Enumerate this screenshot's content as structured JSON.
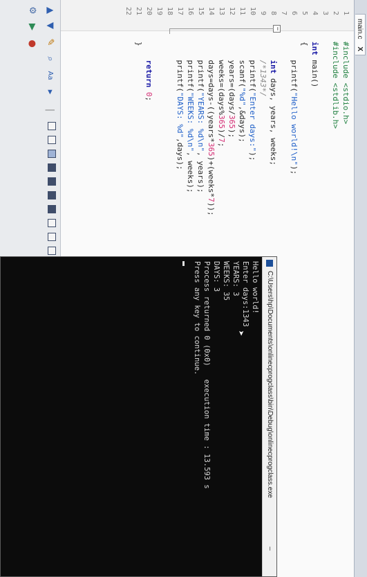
{
  "editor": {
    "tab_label": "main.c",
    "tab_close": "X",
    "line_numbers": [
      "1",
      "2",
      "3",
      "4",
      "5",
      "6",
      "7",
      "8",
      "9",
      "10",
      "11",
      "12",
      "13",
      "14",
      "15",
      "16",
      "17",
      "18",
      "19",
      "20",
      "21",
      "22"
    ],
    "code": {
      "l1_a": "#include ",
      "l1_b": "<stdio.h>",
      "l2_a": "#include ",
      "l2_b": "<stdlib.h>",
      "l4_a": "int",
      "l4_b": " main()",
      "l5": "{",
      "l6_a": "    printf(",
      "l6_b": "\"Hello world!\\n\"",
      "l6_c": ");",
      "l8_a": "    int",
      "l8_b": " days, years, weeks;",
      "l9": "    /*1343*/",
      "l10_a": "    printf(",
      "l10_b": "\"Enter days:\"",
      "l10_c": ");",
      "l11_a": "    scanf(",
      "l11_b": "\"%d\"",
      "l11_c": ",&days);",
      "l12_a": "    years=(days/",
      "l12_b": "365",
      "l12_c": ");",
      "l13_a": "    weeks=(days%",
      "l13_b": "365",
      "l13_c": ")/",
      "l13_d": "7",
      "l13_e": ";",
      "l14_a": "    days=days-((years*",
      "l14_b": "365",
      "l14_c": ")+(weeks*",
      "l14_d": "7",
      "l14_e": "));",
      "l15_a": "    printf(",
      "l15_b": "\"YEARS: %d\\n\"",
      "l15_c": ", years);",
      "l16_a": "    printf(",
      "l16_b": "\"WEEKS: %d\\n\"",
      "l16_c": ", weeks);",
      "l17_a": "    printf(",
      "l17_b": "\"DAYS: %d\"",
      "l17_c": ",days);",
      "l20_a": "    return ",
      "l20_b": "0",
      "l20_c": ";",
      "l21": "}"
    }
  },
  "console": {
    "title": "C:\\Users\\hp\\Documents\\onlinecprogclass\\bin\\Debug\\onlinecprogclass.exe",
    "lines": [
      "Hello world!",
      "Enter days:1343",
      "YEARS: 3",
      "WEEKS: 35",
      "DAYS: 3",
      "Process returned 0 (0x0)   execution time : 13.593 s",
      "Press any key to continue."
    ]
  },
  "colors": {
    "keyword": "#1a1aa6",
    "string": "#1f5fc8",
    "number": "#d42a72",
    "console_bg": "#0c0c0c"
  },
  "toolbar": {
    "icons": [
      "up-arrow-icon",
      "down-arrow-icon",
      "pencil-icon",
      "find-icon",
      "text-icon",
      "run-icon",
      "stop-icon",
      "debug-icon"
    ]
  }
}
